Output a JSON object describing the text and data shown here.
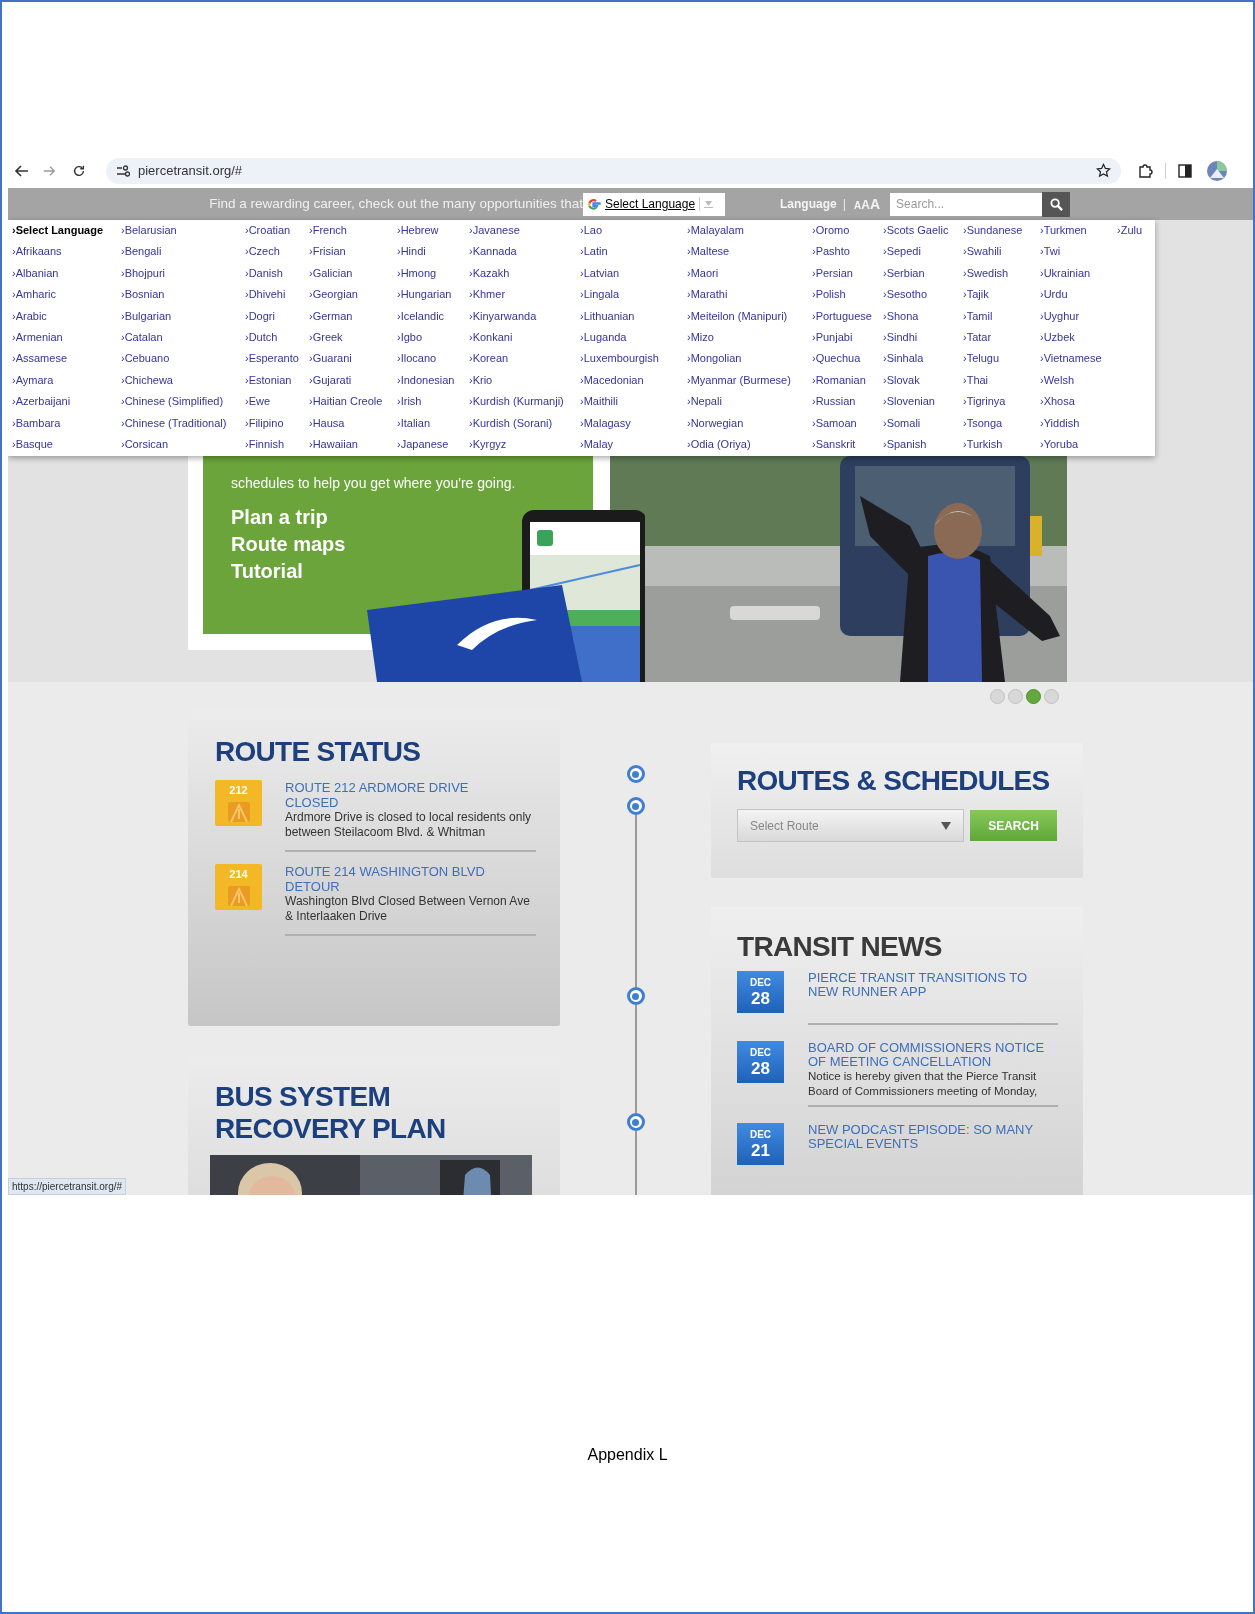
{
  "browser": {
    "url": "piercetransit.org/#",
    "status_url": "https://piercetransit.org/#"
  },
  "top_bar": {
    "marquee": "Find a rewarding career, check out the many opportunities that",
    "translate_label": "Select Language",
    "language_link": "Language",
    "separator": "|",
    "text_size": "AAA",
    "search": {
      "placeholder": "Search..."
    }
  },
  "language_menu": {
    "columns": [
      [
        {
          "label": "›Select Language",
          "selected": true
        },
        {
          "label": "›Afrikaans",
          "selected": false
        },
        {
          "label": "›Albanian",
          "selected": false
        },
        {
          "label": "›Amharic",
          "selected": false
        },
        {
          "label": "›Arabic",
          "selected": false
        },
        {
          "label": "›Armenian",
          "selected": false
        },
        {
          "label": "›Assamese",
          "selected": false
        },
        {
          "label": "›Aymara",
          "selected": false
        },
        {
          "label": "›Azerbaijani",
          "selected": false
        },
        {
          "label": "›Bambara",
          "selected": false
        },
        {
          "label": "›Basque",
          "selected": false
        }
      ],
      [
        {
          "label": "›Belarusian",
          "selected": false
        },
        {
          "label": "›Bengali",
          "selected": false
        },
        {
          "label": "›Bhojpuri",
          "selected": false
        },
        {
          "label": "›Bosnian",
          "selected": false
        },
        {
          "label": "›Bulgarian",
          "selected": false
        },
        {
          "label": "›Catalan",
          "selected": false
        },
        {
          "label": "›Cebuano",
          "selected": false
        },
        {
          "label": "›Chichewa",
          "selected": false
        },
        {
          "label": "›Chinese (Simplified)",
          "selected": false
        },
        {
          "label": "›Chinese (Traditional)",
          "selected": false
        },
        {
          "label": "›Corsican",
          "selected": false
        }
      ],
      [
        {
          "label": "›Croatian",
          "selected": false
        },
        {
          "label": "›Czech",
          "selected": false
        },
        {
          "label": "›Danish",
          "selected": false
        },
        {
          "label": "›Dhivehi",
          "selected": false
        },
        {
          "label": "›Dogri",
          "selected": false
        },
        {
          "label": "›Dutch",
          "selected": false
        },
        {
          "label": "›Esperanto",
          "selected": false
        },
        {
          "label": "›Estonian",
          "selected": false
        },
        {
          "label": "›Ewe",
          "selected": false
        },
        {
          "label": "›Filipino",
          "selected": false
        },
        {
          "label": "›Finnish",
          "selected": false
        }
      ],
      [
        {
          "label": "›French",
          "selected": false
        },
        {
          "label": "›Frisian",
          "selected": false
        },
        {
          "label": "›Galician",
          "selected": false
        },
        {
          "label": "›Georgian",
          "selected": false
        },
        {
          "label": "›German",
          "selected": false
        },
        {
          "label": "›Greek",
          "selected": false
        },
        {
          "label": "›Guarani",
          "selected": false
        },
        {
          "label": "›Gujarati",
          "selected": false
        },
        {
          "label": "›Haitian Creole",
          "selected": false
        },
        {
          "label": "›Hausa",
          "selected": false
        },
        {
          "label": "›Hawaiian",
          "selected": false
        }
      ],
      [
        {
          "label": "›Hebrew",
          "selected": false
        },
        {
          "label": "›Hindi",
          "selected": false
        },
        {
          "label": "›Hmong",
          "selected": false
        },
        {
          "label": "›Hungarian",
          "selected": false
        },
        {
          "label": "›Icelandic",
          "selected": false
        },
        {
          "label": "›Igbo",
          "selected": false
        },
        {
          "label": "›Ilocano",
          "selected": false
        },
        {
          "label": "›Indonesian",
          "selected": false
        },
        {
          "label": "›Irish",
          "selected": false
        },
        {
          "label": "›Italian",
          "selected": false
        },
        {
          "label": "›Japanese",
          "selected": false
        }
      ],
      [
        {
          "label": "›Javanese",
          "selected": false
        },
        {
          "label": "›Kannada",
          "selected": false
        },
        {
          "label": "›Kazakh",
          "selected": false
        },
        {
          "label": "›Khmer",
          "selected": false
        },
        {
          "label": "›Kinyarwanda",
          "selected": false
        },
        {
          "label": "›Konkani",
          "selected": false
        },
        {
          "label": "›Korean",
          "selected": false
        },
        {
          "label": "›Krio",
          "selected": false
        },
        {
          "label": "›Kurdish (Kurmanji)",
          "selected": false
        },
        {
          "label": "›Kurdish (Sorani)",
          "selected": false
        },
        {
          "label": "›Kyrgyz",
          "selected": false
        }
      ],
      [
        {
          "label": "›Lao",
          "selected": false
        },
        {
          "label": "›Latin",
          "selected": false
        },
        {
          "label": "›Latvian",
          "selected": false
        },
        {
          "label": "›Lingala",
          "selected": false
        },
        {
          "label": "›Lithuanian",
          "selected": false
        },
        {
          "label": "›Luganda",
          "selected": false
        },
        {
          "label": "›Luxembourgish",
          "selected": false
        },
        {
          "label": "›Macedonian",
          "selected": false
        },
        {
          "label": "›Maithili",
          "selected": false
        },
        {
          "label": "›Malagasy",
          "selected": false
        },
        {
          "label": "›Malay",
          "selected": false
        }
      ],
      [
        {
          "label": "›Malayalam",
          "selected": false
        },
        {
          "label": "›Maltese",
          "selected": false
        },
        {
          "label": "›Maori",
          "selected": false
        },
        {
          "label": "›Marathi",
          "selected": false
        },
        {
          "label": "›Meiteilon (Manipuri)",
          "selected": false
        },
        {
          "label": "›Mizo",
          "selected": false
        },
        {
          "label": "›Mongolian",
          "selected": false
        },
        {
          "label": "›Myanmar (Burmese)",
          "selected": false
        },
        {
          "label": "›Nepali",
          "selected": false
        },
        {
          "label": "›Norwegian",
          "selected": false
        },
        {
          "label": "›Odia (Oriya)",
          "selected": false
        }
      ],
      [
        {
          "label": "›Oromo",
          "selected": false
        },
        {
          "label": "›Pashto",
          "selected": false
        },
        {
          "label": "›Persian",
          "selected": false
        },
        {
          "label": "›Polish",
          "selected": false
        },
        {
          "label": "›Portuguese",
          "selected": false
        },
        {
          "label": "›Punjabi",
          "selected": false
        },
        {
          "label": "›Quechua",
          "selected": false
        },
        {
          "label": "›Romanian",
          "selected": false
        },
        {
          "label": "›Russian",
          "selected": false
        },
        {
          "label": "›Samoan",
          "selected": false
        },
        {
          "label": "›Sanskrit",
          "selected": false
        }
      ],
      [
        {
          "label": "›Scots Gaelic",
          "selected": false
        },
        {
          "label": "›Sepedi",
          "selected": false
        },
        {
          "label": "›Serbian",
          "selected": false
        },
        {
          "label": "›Sesotho",
          "selected": false
        },
        {
          "label": "›Shona",
          "selected": false
        },
        {
          "label": "›Sindhi",
          "selected": false
        },
        {
          "label": "›Sinhala",
          "selected": false
        },
        {
          "label": "›Slovak",
          "selected": false
        },
        {
          "label": "›Slovenian",
          "selected": false
        },
        {
          "label": "›Somali",
          "selected": false
        },
        {
          "label": "›Spanish",
          "selected": false
        }
      ],
      [
        {
          "label": "›Sundanese",
          "selected": false
        },
        {
          "label": "›Swahili",
          "selected": false
        },
        {
          "label": "›Swedish",
          "selected": false
        },
        {
          "label": "›Tajik",
          "selected": false
        },
        {
          "label": "›Tamil",
          "selected": false
        },
        {
          "label": "›Tatar",
          "selected": false
        },
        {
          "label": "›Telugu",
          "selected": false
        },
        {
          "label": "›Thai",
          "selected": false
        },
        {
          "label": "›Tigrinya",
          "selected": false
        },
        {
          "label": "›Tsonga",
          "selected": false
        },
        {
          "label": "›Turkish",
          "selected": false
        }
      ],
      [
        {
          "label": "›Turkmen",
          "selected": false
        },
        {
          "label": "›Twi",
          "selected": false
        },
        {
          "label": "›Ukrainian",
          "selected": false
        },
        {
          "label": "›Urdu",
          "selected": false
        },
        {
          "label": "›Uyghur",
          "selected": false
        },
        {
          "label": "›Uzbek",
          "selected": false
        },
        {
          "label": "›Vietnamese",
          "selected": false
        },
        {
          "label": "›Welsh",
          "selected": false
        },
        {
          "label": "›Xhosa",
          "selected": false
        },
        {
          "label": "›Yiddish",
          "selected": false
        },
        {
          "label": "›Yoruba",
          "selected": false
        }
      ],
      [
        {
          "label": "›Zulu",
          "selected": false
        }
      ]
    ]
  },
  "hero": {
    "intro": "schedules to help you get where you're going.",
    "links": [
      "Plan a trip",
      "Route maps",
      "Tutorial"
    ],
    "slides": [
      {
        "selected": false
      },
      {
        "selected": false
      },
      {
        "selected": true
      },
      {
        "selected": false
      }
    ]
  },
  "route_status": {
    "title": "ROUTE STATUS",
    "items": [
      {
        "route": "212",
        "title": "ROUTE 212 ARDMORE DRIVE CLOSED",
        "description": "Ardmore Drive is closed to local residents only between Steilacoom Blvd. & Whitman"
      },
      {
        "route": "214",
        "title": "ROUTE 214 WASHINGTON BLVD DETOUR",
        "description": "Washington Blvd Closed Between Vernon Ave & Interlaaken Drive"
      }
    ]
  },
  "recovery": {
    "title": "BUS SYSTEM RECOVERY PLAN"
  },
  "routes": {
    "title": "ROUTES & SCHEDULES",
    "select": {
      "placeholder": "Select Route"
    },
    "button": "SEARCH"
  },
  "news": {
    "title": "TRANSIT NEWS",
    "items": [
      {
        "month": "DEC",
        "day": "28",
        "title": "PIERCE TRANSIT TRANSITIONS TO NEW RUNNER APP"
      },
      {
        "month": "DEC",
        "day": "28",
        "title": "BOARD OF COMMISSIONERS NOTICE OF MEETING CANCELLATION",
        "description": "Notice is hereby given that the Pierce Transit Board of Commissioners meeting of Monday,"
      },
      {
        "month": "DEC",
        "day": "21",
        "title": "NEW PODCAST EPISODE: SO MANY SPECIAL EVENTS"
      }
    ]
  },
  "footer": {
    "caption": "Appendix L"
  }
}
